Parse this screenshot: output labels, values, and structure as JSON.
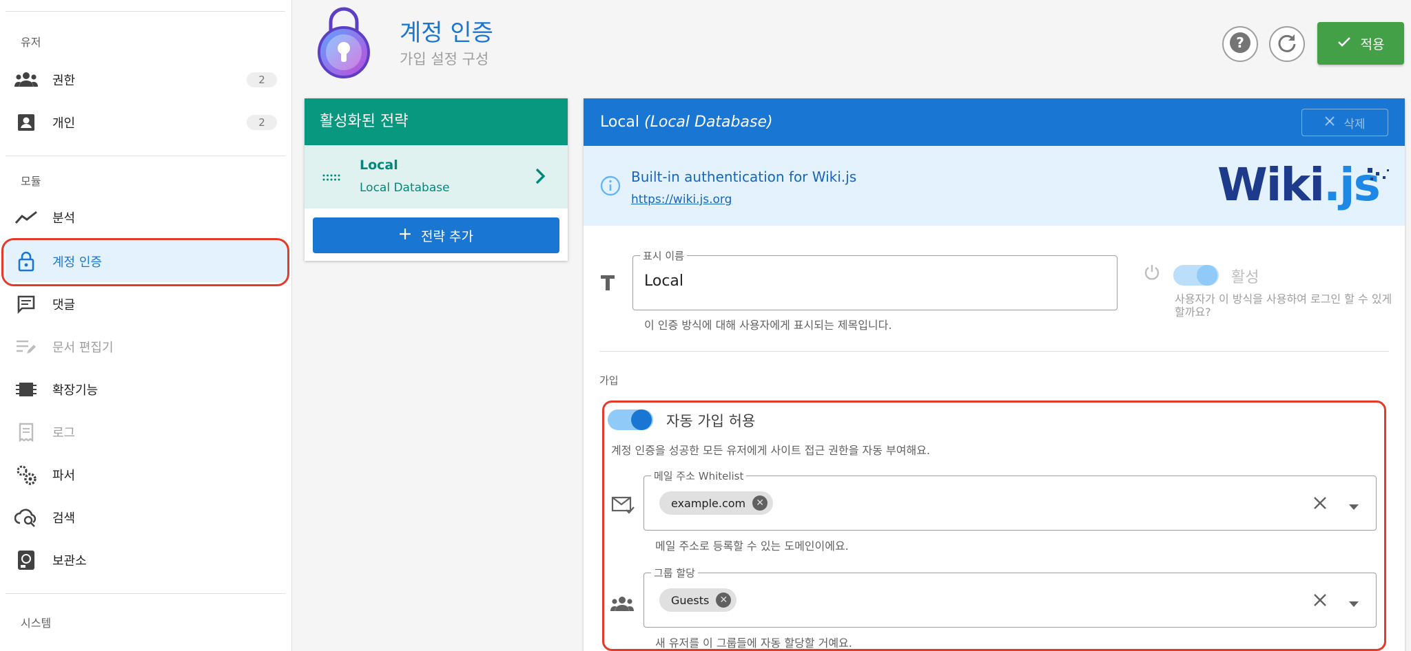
{
  "sidebar": {
    "section_users": "유저",
    "section_modules": "모듈",
    "section_system": "시스템",
    "items": [
      {
        "label": "권한",
        "count": "2",
        "icon": "groups-icon"
      },
      {
        "label": "개인",
        "count": "2",
        "icon": "account-box-icon"
      },
      {
        "label": "분석",
        "icon": "chart-line-icon"
      },
      {
        "label": "계정 인증",
        "icon": "lock-icon",
        "active": true
      },
      {
        "label": "댓글",
        "icon": "comment-icon"
      },
      {
        "label": "문서 편집기",
        "icon": "edit-note-icon",
        "disabled": true
      },
      {
        "label": "확장기능",
        "icon": "chip-icon"
      },
      {
        "label": "로그",
        "icon": "receipt-icon",
        "disabled": true
      },
      {
        "label": "파서",
        "icon": "gears-icon"
      },
      {
        "label": "검색",
        "icon": "cloud-search-icon"
      },
      {
        "label": "보관소",
        "icon": "storage-icon"
      }
    ]
  },
  "header": {
    "title": "계정 인증",
    "subtitle": "가입 설정 구성",
    "apply_label": "적용"
  },
  "strategies": {
    "title": "활성화된 전략",
    "items": [
      {
        "name": "Local",
        "sub": "Local Database"
      }
    ],
    "add_label": "전략 추가"
  },
  "strategy_detail": {
    "title_main": "Local",
    "title_sub": "(Local Database)",
    "delete_label": "삭제",
    "info_text": "Built-in authentication for Wiki.js",
    "info_link": "https://wiki.js.org",
    "logo_text": "Wiki",
    "logo_suffix": ".js",
    "display_name_label": "표시 이름",
    "display_name_value": "Local",
    "display_name_hint": "이 인증 방식에 대해 사용자에게 표시되는 제목입니다.",
    "active_label": "활성",
    "active_hint": "사용자가 이 방식을 사용하여 로그인 할 수 있게 할까요?",
    "signup_section": "가입",
    "auto_signup_label": "자동 가입 허용",
    "auto_signup_hint": "계정 인증을 성공한 모든 유저에게 사이트 접근 권한을 자동 부여해요.",
    "email_whitelist_label": "메일 주소 Whitelist",
    "email_whitelist_chip": "example.com",
    "email_whitelist_hint": "메일 주소로 등록할 수 있는 도메인이에요.",
    "group_assign_label": "그룹 할당",
    "group_assign_chip": "Guests",
    "group_assign_hint": "새 유저를 이 그룹들에 자동 할당할 거예요."
  },
  "colors": {
    "primary": "#1976d2",
    "teal": "#07987f",
    "apply_green": "#43a047",
    "highlight_red": "#e53a2a"
  }
}
